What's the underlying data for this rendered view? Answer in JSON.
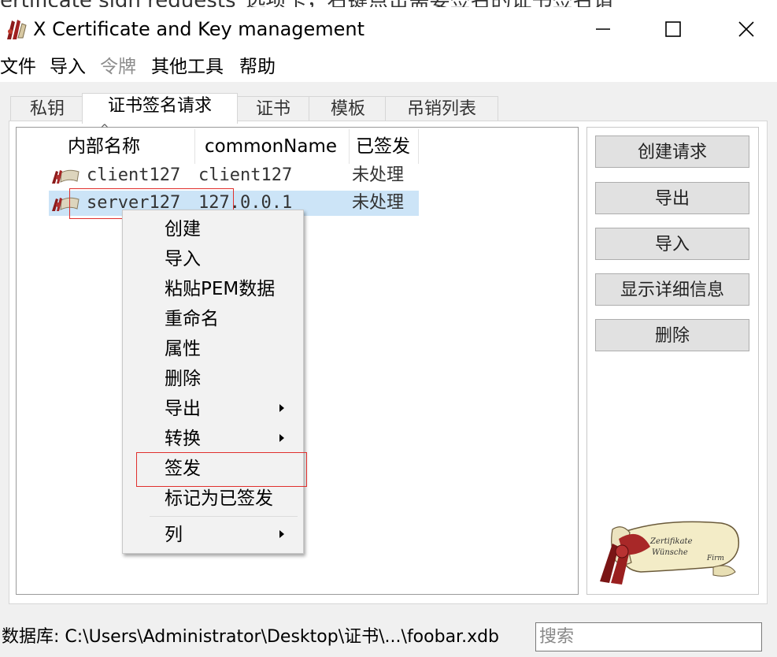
{
  "window": {
    "title_strip": "ertificate sign requests\"选项卡，右键点击需要签名的证书签名请",
    "title": "X Certificate and Key management"
  },
  "menubar": {
    "items": [
      {
        "label": "文件",
        "enabled": true
      },
      {
        "label": "导入",
        "enabled": true
      },
      {
        "label": "令牌",
        "enabled": false
      },
      {
        "label": "其他工具",
        "enabled": true
      },
      {
        "label": "帮助",
        "enabled": true
      }
    ]
  },
  "tabs": [
    {
      "label": "私钥",
      "active": false
    },
    {
      "label": "证书签名请求",
      "active": true
    },
    {
      "label": "证书",
      "active": false
    },
    {
      "label": "模板",
      "active": false
    },
    {
      "label": "吊销列表",
      "active": false
    }
  ],
  "table": {
    "columns": [
      "内部名称",
      "commonName",
      "已签发"
    ],
    "sort_indicator": "^",
    "rows": [
      {
        "name": "client127",
        "common_name": "client127",
        "status": "未处理",
        "selected": false
      },
      {
        "name": "server127",
        "common_name": "127.0.0.1",
        "status": "未处理",
        "selected": true
      }
    ]
  },
  "context_menu": {
    "items": [
      {
        "label": "创建",
        "submenu": false
      },
      {
        "label": "导入",
        "submenu": false
      },
      {
        "label": "粘贴PEM数据",
        "submenu": false
      },
      {
        "label": "重命名",
        "submenu": false
      },
      {
        "label": "属性",
        "submenu": false
      },
      {
        "label": "删除",
        "submenu": false
      },
      {
        "label": "导出",
        "submenu": true
      },
      {
        "label": "转换",
        "submenu": true
      },
      {
        "label": "签发",
        "submenu": false,
        "highlighted": true
      },
      {
        "label": "标记为已签发",
        "submenu": false
      },
      {
        "label": "列",
        "submenu": true
      }
    ]
  },
  "side_buttons": [
    "创建请求",
    "导出",
    "导入",
    "显示详细信息",
    "删除"
  ],
  "logo": {
    "text_line1": "Zertifikate",
    "text_line2": "Wünsche",
    "text_line3": "Firm"
  },
  "status_bar": {
    "database_label": "数据库: C:\\Users\\Administrator\\Desktop\\证书\\...\\foobar.xdb",
    "search_placeholder": "搜索"
  },
  "colors": {
    "selection": "#cce4f7",
    "annotation_red": "#e0302e",
    "button_face": "#e1e1e1"
  }
}
